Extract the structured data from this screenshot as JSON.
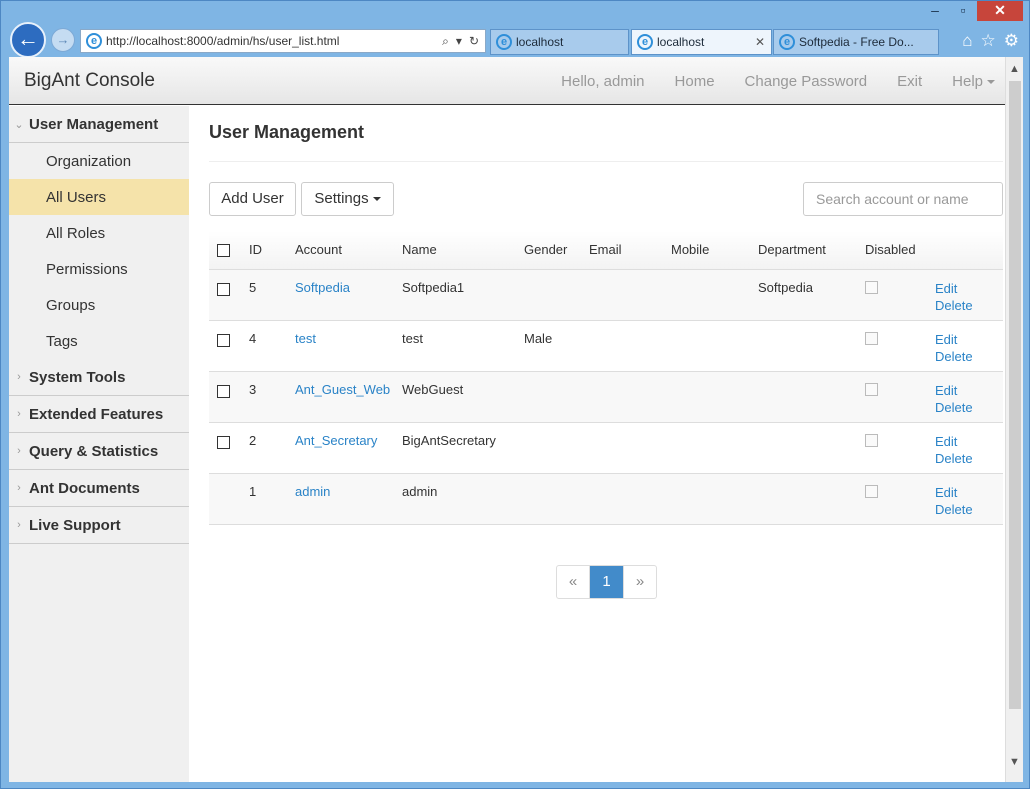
{
  "browser": {
    "address_url": "http://localhost:8000/admin/hs/user_list.html",
    "tabs": [
      {
        "title": "localhost"
      },
      {
        "title": "localhost"
      },
      {
        "title": "Softpedia - Free Do..."
      }
    ]
  },
  "app": {
    "brand": "BigAnt Console",
    "nav": {
      "greeting": "Hello, admin",
      "home": "Home",
      "change_password": "Change Password",
      "exit": "Exit",
      "help": "Help"
    }
  },
  "sidebar": {
    "sections": [
      {
        "label": "User Management",
        "expanded": true
      },
      {
        "label": "System Tools"
      },
      {
        "label": "Extended Features"
      },
      {
        "label": "Query & Statistics"
      },
      {
        "label": "Ant Documents"
      },
      {
        "label": "Live Support"
      }
    ],
    "items": [
      {
        "label": "Organization"
      },
      {
        "label": "All Users",
        "active": true
      },
      {
        "label": "All Roles"
      },
      {
        "label": "Permissions"
      },
      {
        "label": "Groups"
      },
      {
        "label": "Tags"
      }
    ]
  },
  "main": {
    "title": "User Management",
    "add_user": "Add User",
    "settings": "Settings",
    "search_placeholder": "Search account or name",
    "columns": [
      "ID",
      "Account",
      "Name",
      "Gender",
      "Email",
      "Mobile",
      "Department",
      "Disabled"
    ],
    "rows": [
      {
        "id": "5",
        "account": "Softpedia",
        "name": "Softpedia1",
        "gender": "",
        "email": "",
        "mobile": "",
        "department": "Softpedia"
      },
      {
        "id": "4",
        "account": "test",
        "name": "test",
        "gender": "Male",
        "email": "",
        "mobile": "",
        "department": ""
      },
      {
        "id": "3",
        "account": "Ant_Guest_Web",
        "name": "WebGuest",
        "gender": "",
        "email": "",
        "mobile": "",
        "department": ""
      },
      {
        "id": "2",
        "account": "Ant_Secretary",
        "name": "BigAntSecretary",
        "gender": "",
        "email": "",
        "mobile": "",
        "department": ""
      },
      {
        "id": "1",
        "account": "admin",
        "name": "admin",
        "gender": "",
        "email": "",
        "mobile": "",
        "department": ""
      }
    ],
    "edit_label": "Edit",
    "delete_label": "Delete",
    "pagination": {
      "prev": "«",
      "current": "1",
      "next": "»"
    }
  }
}
